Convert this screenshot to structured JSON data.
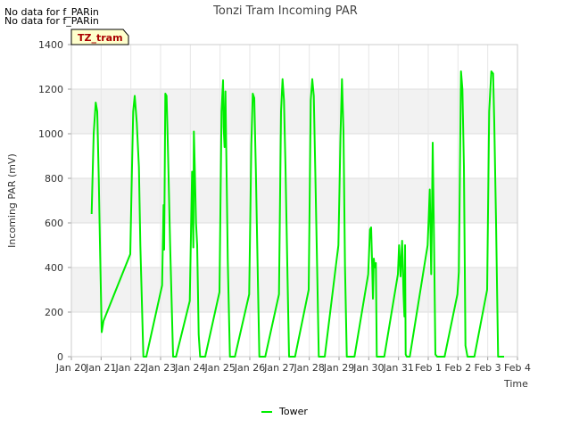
{
  "notes": [
    "No data for f_PARin",
    "No data for f_PARin"
  ],
  "badge": "TZ_tram",
  "chart_data": {
    "type": "line",
    "title": "Tonzi Tram Incoming PAR",
    "xlabel": "Time",
    "ylabel": "Incoming PAR (mV)",
    "ylim": [
      0,
      1400
    ],
    "yticks": [
      0,
      200,
      400,
      600,
      800,
      1000,
      1200,
      1400
    ],
    "xlim": [
      20,
      35
    ],
    "xticks": [
      {
        "v": 20,
        "label": "Jan 20"
      },
      {
        "v": 21,
        "label": "Jan 21"
      },
      {
        "v": 22,
        "label": "Jan 22"
      },
      {
        "v": 23,
        "label": "Jan 23"
      },
      {
        "v": 24,
        "label": "Jan 24"
      },
      {
        "v": 25,
        "label": "Jan 25"
      },
      {
        "v": 26,
        "label": "Jan 26"
      },
      {
        "v": 27,
        "label": "Jan 27"
      },
      {
        "v": 28,
        "label": "Jan 28"
      },
      {
        "v": 29,
        "label": "Jan 29"
      },
      {
        "v": 30,
        "label": "Jan 30"
      },
      {
        "v": 31,
        "label": "Jan 31"
      },
      {
        "v": 32,
        "label": "Feb 1"
      },
      {
        "v": 33,
        "label": "Feb 2"
      },
      {
        "v": 34,
        "label": "Feb 3"
      },
      {
        "v": 35,
        "label": "Feb 4"
      }
    ],
    "grid": true,
    "legend_position": "bottom-center",
    "series": [
      {
        "name": "Tower",
        "color": "#00ee00",
        "x": [
          20.68,
          20.75,
          20.82,
          20.87,
          20.92,
          20.97,
          21.02,
          21.08,
          21.98,
          22.03,
          22.08,
          22.13,
          22.2,
          22.27,
          22.32,
          22.42,
          22.52,
          23.05,
          23.1,
          23.12,
          23.16,
          23.2,
          23.23,
          23.27,
          23.32,
          23.42,
          23.52,
          23.98,
          24.06,
          24.1,
          24.12,
          24.15,
          24.19,
          24.23,
          24.28,
          24.33,
          24.4,
          24.5,
          24.98,
          25.05,
          25.1,
          25.12,
          25.15,
          25.18,
          25.21,
          25.26,
          25.33,
          25.4,
          25.5,
          25.98,
          26.05,
          26.1,
          26.15,
          26.2,
          26.27,
          26.32,
          26.38,
          26.45,
          26.52,
          26.98,
          27.05,
          27.1,
          27.15,
          27.2,
          27.27,
          27.32,
          27.38,
          27.45,
          27.52,
          27.98,
          28.05,
          28.1,
          28.15,
          28.2,
          28.27,
          28.32,
          28.38,
          28.45,
          28.52,
          28.98,
          29.05,
          29.1,
          29.15,
          29.2,
          29.26,
          29.31,
          29.37,
          29.45,
          29.52,
          29.98,
          30.04,
          30.08,
          30.11,
          30.14,
          30.17,
          30.2,
          30.24,
          30.27,
          30.3,
          30.35,
          30.45,
          30.52,
          30.98,
          31.02,
          31.07,
          31.12,
          31.17,
          31.2,
          31.22,
          31.24,
          31.28,
          31.32,
          31.38,
          31.98,
          32.05,
          32.1,
          32.12,
          32.15,
          32.2,
          32.24,
          32.3,
          32.35,
          32.4,
          32.48,
          32.55,
          32.98,
          33.03,
          33.07,
          33.1,
          33.15,
          33.2,
          33.25,
          33.32,
          33.38,
          33.45,
          33.55,
          33.98,
          34.05,
          34.12,
          34.18,
          34.22,
          34.28,
          34.35,
          34.45,
          34.55
        ],
        "y": [
          640,
          1000,
          1140,
          1100,
          800,
          450,
          110,
          160,
          460,
          800,
          1100,
          1170,
          1050,
          850,
          500,
          0,
          0,
          320,
          680,
          480,
          1180,
          1170,
          1020,
          800,
          500,
          0,
          0,
          250,
          830,
          490,
          1010,
          850,
          600,
          500,
          100,
          0,
          0,
          0,
          290,
          1100,
          1240,
          1030,
          940,
          1190,
          900,
          430,
          0,
          0,
          0,
          280,
          950,
          1180,
          1160,
          850,
          350,
          0,
          0,
          0,
          0,
          280,
          1100,
          1245,
          1150,
          850,
          350,
          0,
          0,
          0,
          0,
          300,
          1150,
          1245,
          1170,
          850,
          350,
          0,
          0,
          0,
          0,
          500,
          1000,
          1245,
          1010,
          400,
          0,
          0,
          0,
          0,
          0,
          370,
          570,
          580,
          430,
          260,
          440,
          400,
          420,
          0,
          0,
          0,
          0,
          0,
          370,
          500,
          360,
          520,
          280,
          180,
          500,
          10,
          0,
          0,
          0,
          500,
          750,
          370,
          580,
          960,
          450,
          10,
          0,
          0,
          0,
          0,
          0,
          280,
          380,
          900,
          1280,
          1200,
          850,
          50,
          0,
          0,
          0,
          0,
          300,
          1100,
          1280,
          1270,
          1050,
          600,
          0,
          0,
          0
        ]
      }
    ]
  }
}
